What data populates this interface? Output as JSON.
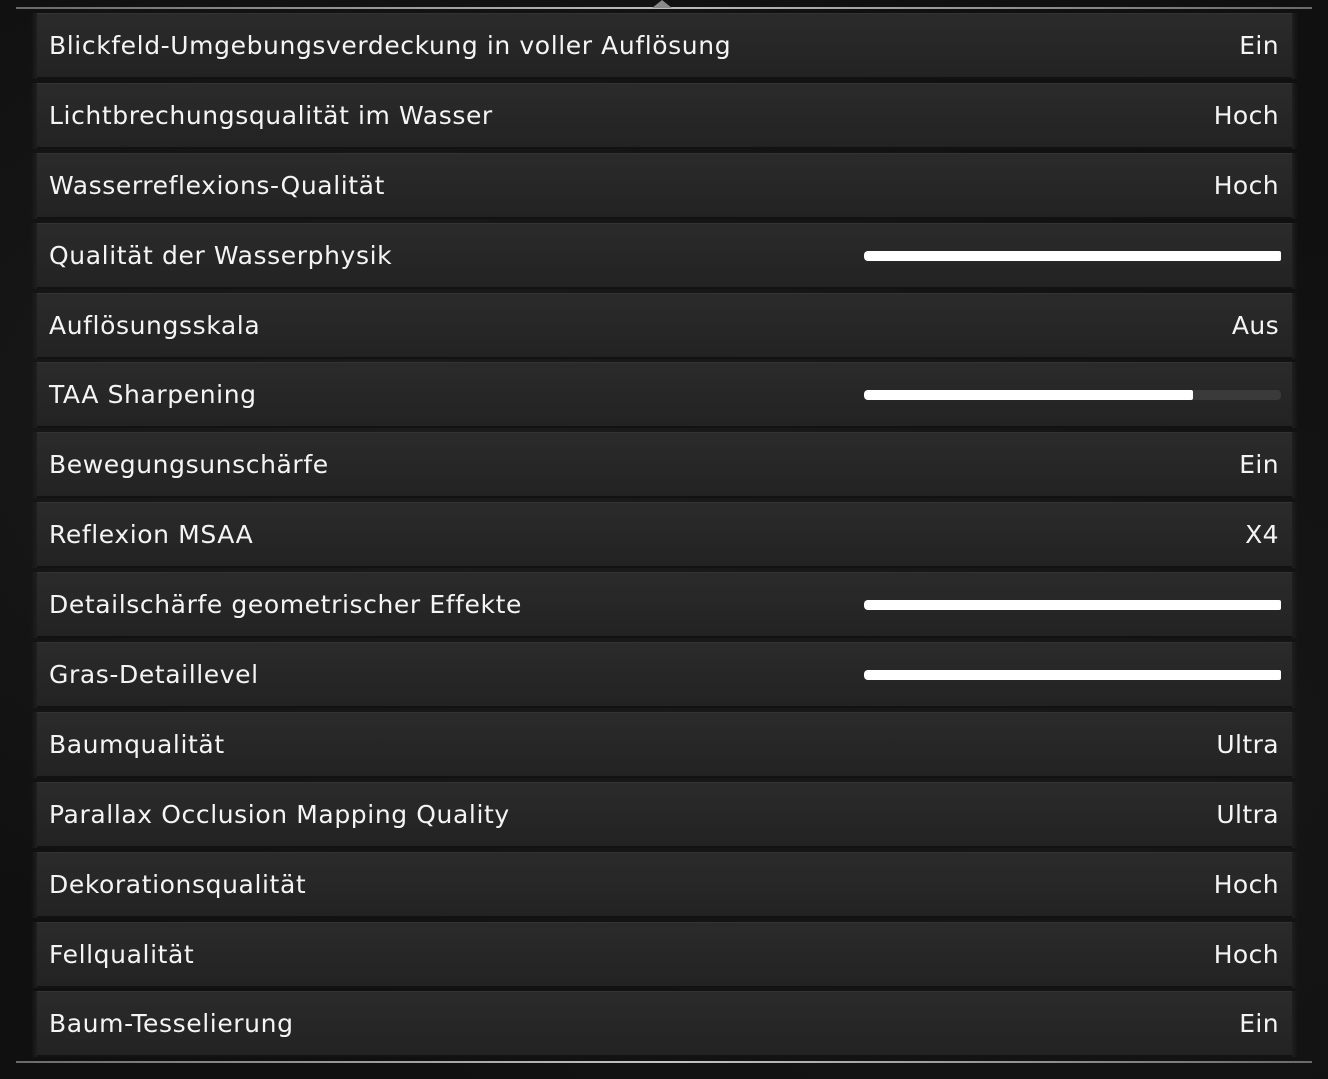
{
  "settings": [
    {
      "label": "Blickfeld-Umgebungsverdeckung in voller Auflösung",
      "type": "value",
      "value": "Ein"
    },
    {
      "label": "Lichtbrechungsqualität im Wasser",
      "type": "value",
      "value": "Hoch"
    },
    {
      "label": "Wasserreflexions-Qualität",
      "type": "value",
      "value": "Hoch"
    },
    {
      "label": "Qualität der Wasserphysik",
      "type": "slider",
      "fraction": 1.0
    },
    {
      "label": "Auflösungsskala",
      "type": "value",
      "value": "Aus"
    },
    {
      "label": "TAA Sharpening",
      "type": "slider",
      "fraction": 0.79
    },
    {
      "label": "Bewegungsunschärfe",
      "type": "value",
      "value": "Ein"
    },
    {
      "label": "Reflexion MSAA",
      "type": "value",
      "value": "X4"
    },
    {
      "label": "Detailschärfe geometrischer Effekte",
      "type": "slider",
      "fraction": 1.0
    },
    {
      "label": "Gras-Detaillevel",
      "type": "slider",
      "fraction": 1.0
    },
    {
      "label": "Baumqualität",
      "type": "value",
      "value": "Ultra"
    },
    {
      "label": "Parallax Occlusion Mapping Quality",
      "type": "value",
      "value": "Ultra"
    },
    {
      "label": "Dekorationsqualität",
      "type": "value",
      "value": "Hoch"
    },
    {
      "label": "Fellqualität",
      "type": "value",
      "value": "Hoch"
    },
    {
      "label": "Baum-Tesselierung",
      "type": "value",
      "value": "Ein"
    }
  ]
}
